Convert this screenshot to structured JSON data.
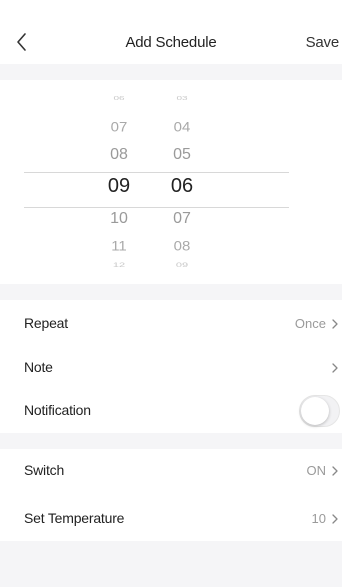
{
  "header": {
    "back_icon": "chevron-left-icon",
    "title": "Add Schedule",
    "save_label": "Save"
  },
  "picker": {
    "hours": [
      "06",
      "07",
      "08",
      "09",
      "10",
      "11",
      "12"
    ],
    "minutes": [
      "03",
      "04",
      "05",
      "06",
      "07",
      "08",
      "09"
    ],
    "selected_hour": "09",
    "selected_minute": "06"
  },
  "settings": {
    "repeat": {
      "label": "Repeat",
      "value": "Once"
    },
    "note": {
      "label": "Note",
      "value": ""
    },
    "notification": {
      "label": "Notification",
      "enabled": false
    },
    "switch": {
      "label": "Switch",
      "value": "ON"
    },
    "temperature": {
      "label": "Set Temperature",
      "value": "10"
    }
  },
  "colors": {
    "section_background": "#f5f5f7",
    "secondary_text": "#9a9a9a"
  }
}
